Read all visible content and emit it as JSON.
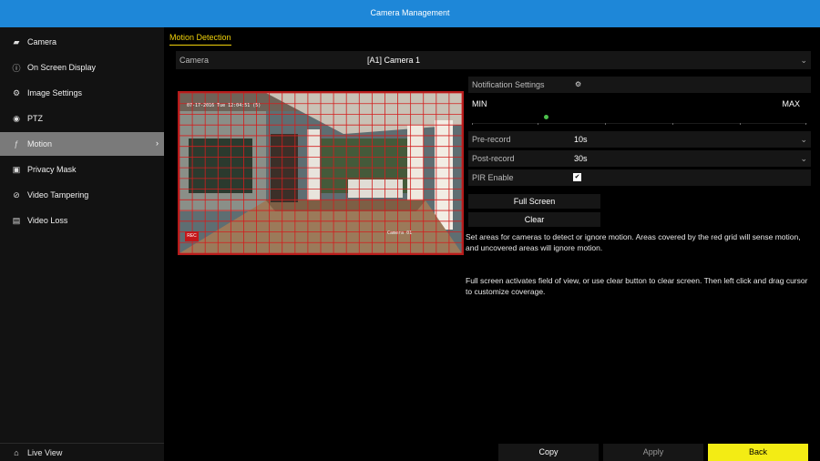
{
  "window": {
    "title": "Camera Management"
  },
  "sidebar": {
    "items": [
      {
        "label": "Camera",
        "icon": "camera-icon"
      },
      {
        "label": "On Screen Display",
        "icon": "info-icon"
      },
      {
        "label": "Image Settings",
        "icon": "image-settings-icon"
      },
      {
        "label": "PTZ",
        "icon": "ptz-icon"
      },
      {
        "label": "Motion",
        "icon": "motion-icon",
        "active": true
      },
      {
        "label": "Privacy Mask",
        "icon": "privacy-mask-icon"
      },
      {
        "label": "Video Tampering",
        "icon": "no-entry-icon"
      },
      {
        "label": "Video Loss",
        "icon": "video-loss-icon"
      }
    ],
    "live_view": "Live View"
  },
  "main": {
    "tab": "Motion Detection",
    "camera_label": "Camera",
    "camera_value": "[A1] Camera 1",
    "preview": {
      "timestamp": "07-17-2016 Tue 12:04:51 (5)",
      "rec_badge": "REC",
      "camera_overlay": "Camera 01"
    },
    "settings": {
      "notification_label": "Notification Settings",
      "sensitivity_min": "MIN",
      "sensitivity_max": "MAX",
      "sensitivity_level": 0.22,
      "pre_record_label": "Pre-record",
      "pre_record_value": "10s",
      "post_record_label": "Post-record",
      "post_record_value": "30s",
      "pir_label": "PIR Enable",
      "pir_enabled": true
    },
    "buttons": {
      "full_screen": "Full Screen",
      "clear": "Clear"
    },
    "help_text_1": "Set areas for cameras to detect or ignore motion. Areas covered by the red grid will sense motion, and uncovered areas will ignore motion.",
    "help_text_2": "Full screen activates field of view, or use clear button to clear screen. Then left click and drag cursor to customize coverage."
  },
  "footer": {
    "copy": "Copy",
    "apply": "Apply",
    "back": "Back"
  },
  "colors": {
    "titlebar": "#1e87d8",
    "accent_tab": "#f1d20a",
    "back_button": "#f3ec14",
    "grid": "#d21e1e",
    "slider_knob": "#4cc04c"
  }
}
